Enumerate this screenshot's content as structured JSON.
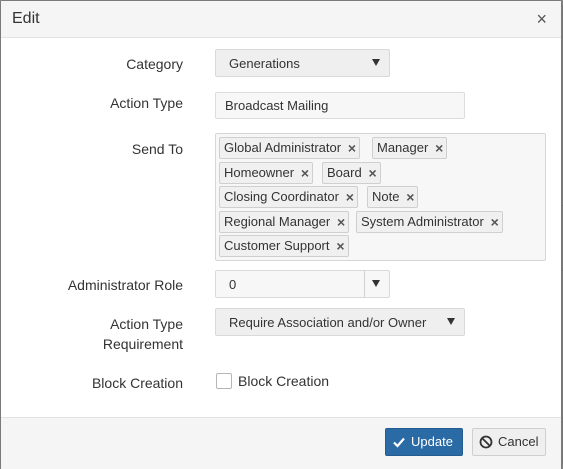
{
  "dialog": {
    "title": "Edit",
    "close_glyph": "×"
  },
  "form": {
    "category": {
      "label": "Category",
      "value": "Generations"
    },
    "action_type": {
      "label": "Action Type",
      "value": "Broadcast Mailing"
    },
    "send_to": {
      "label": "Send To",
      "tags": [
        "Global Administrator",
        "Manager",
        "Homeowner",
        "Board",
        "Closing Coordinator",
        "Note",
        "Regional Manager",
        "System Administrator",
        "Customer Support"
      ],
      "remove_glyph": "×"
    },
    "administrator_role": {
      "label": "Administrator Role",
      "value": "0"
    },
    "action_type_requirement": {
      "label_line1": "Action Type",
      "label_line2": "Requirement",
      "value": "Require Association and/or Owner"
    },
    "block_creation": {
      "label": "Block Creation",
      "checkbox_label": "Block Creation",
      "checked": false
    }
  },
  "footer": {
    "update_label": "Update",
    "update_icon": "check-icon",
    "cancel_label": "Cancel",
    "cancel_icon": "ban-icon"
  },
  "colors": {
    "primary": "#2a6ba6",
    "header_bg": "#f5f5f5"
  }
}
